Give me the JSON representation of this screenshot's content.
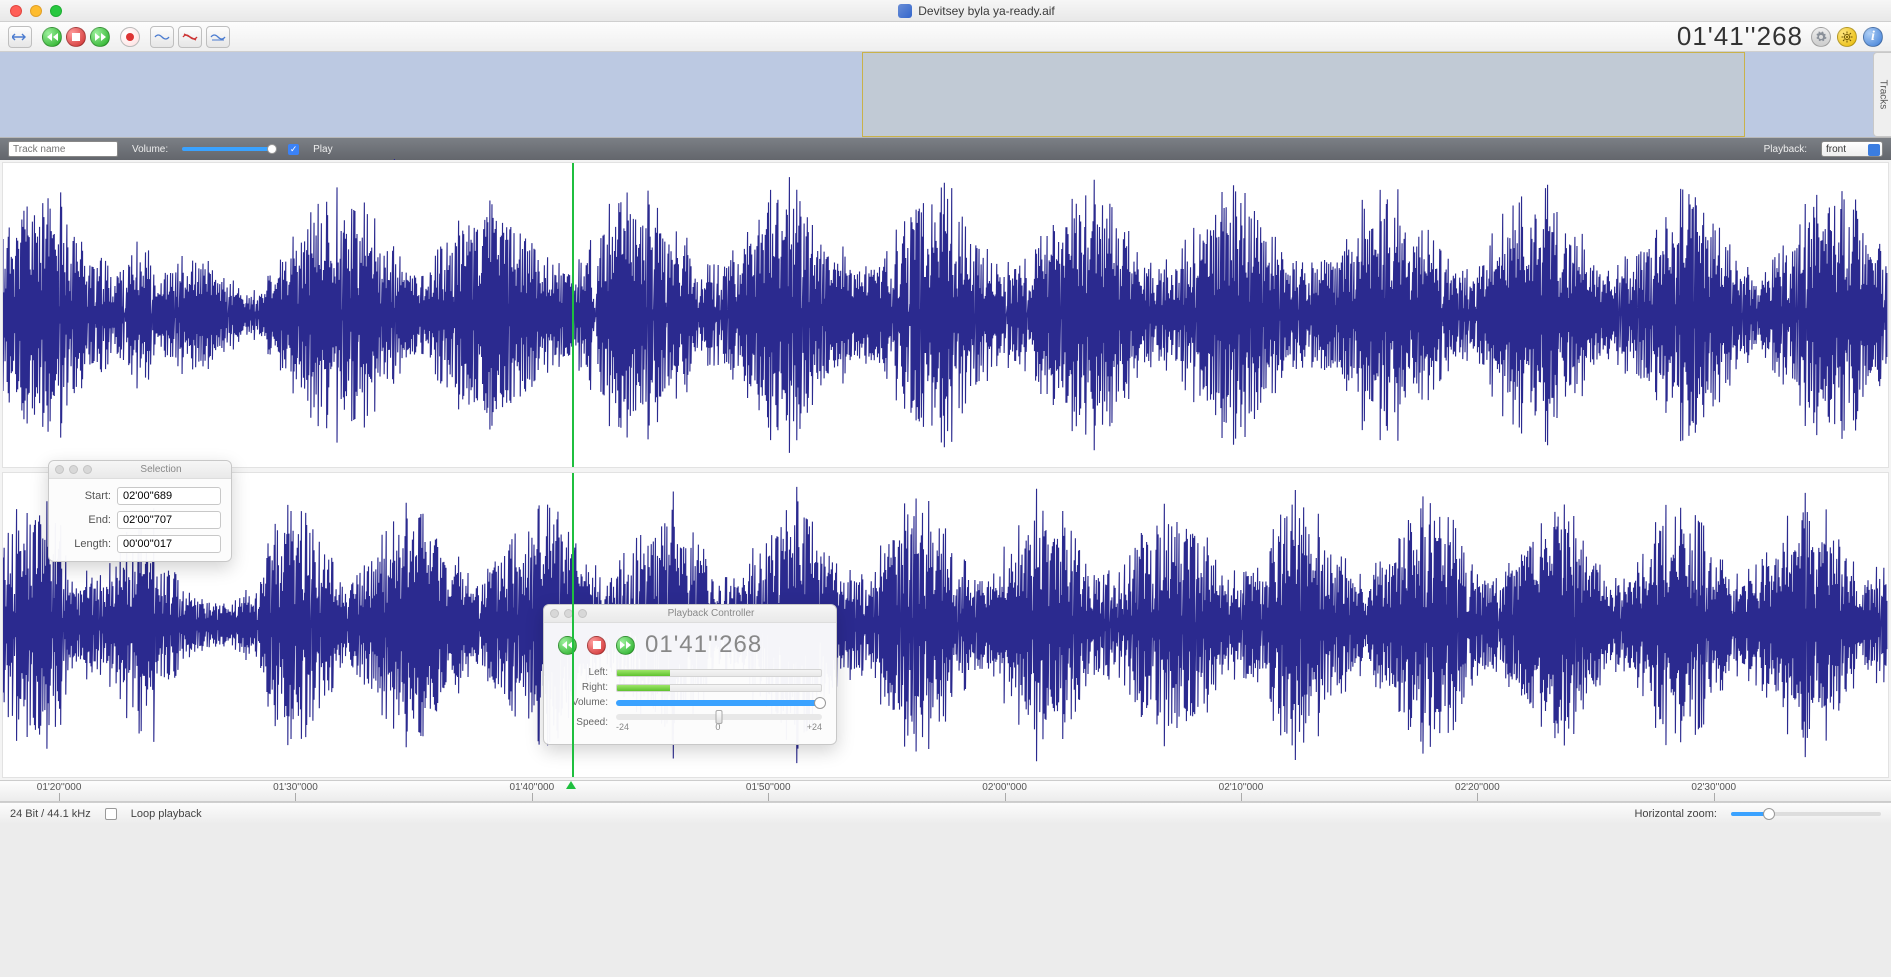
{
  "window": {
    "title": "Devitsey byla ya-ready.aif"
  },
  "toolbar": {
    "timecode": "01'41''268"
  },
  "tracks_tab": "Tracks",
  "controls": {
    "trackname_placeholder": "Track name",
    "volume_label": "Volume:",
    "play_label": "Play",
    "playback_label": "Playback:",
    "playback_value": "front"
  },
  "overview": {
    "selection_left_pct": 45.6,
    "selection_right_pct": 92.3
  },
  "ruler": {
    "ticks": [
      "01'20''000",
      "01'30''000",
      "01'40''000",
      "01'50''000",
      "02'00''000",
      "02'10''000",
      "02'20''000",
      "02'30''000"
    ]
  },
  "playhead_pct": 30.2,
  "selection": {
    "panel_title": "Selection",
    "start_label": "Start:",
    "end_label": "End:",
    "length_label": "Length:",
    "start": "02'00''689",
    "end": "02'00''707",
    "length": "00'00''017"
  },
  "playback_controller": {
    "panel_title": "Playback Controller",
    "timecode": "01'41''268",
    "left_label": "Left:",
    "right_label": "Right:",
    "volume_label": "Volume:",
    "speed_label": "Speed:",
    "tick_minus": "-24",
    "tick_zero": "0",
    "tick_plus": "+24"
  },
  "status": {
    "format": "24 Bit / 44.1 kHz",
    "loop_label": "Loop playback",
    "hzoom_label": "Horizontal zoom:"
  }
}
